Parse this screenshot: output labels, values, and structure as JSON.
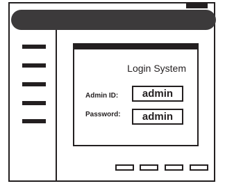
{
  "login_panel": {
    "title": "Login System",
    "admin_id_label": "Admin ID:",
    "admin_id_value": "admin",
    "password_label": "Password:",
    "password_value": "admin"
  },
  "sidebar": {
    "item_count": 5
  },
  "footer": {
    "button_count": 4
  }
}
